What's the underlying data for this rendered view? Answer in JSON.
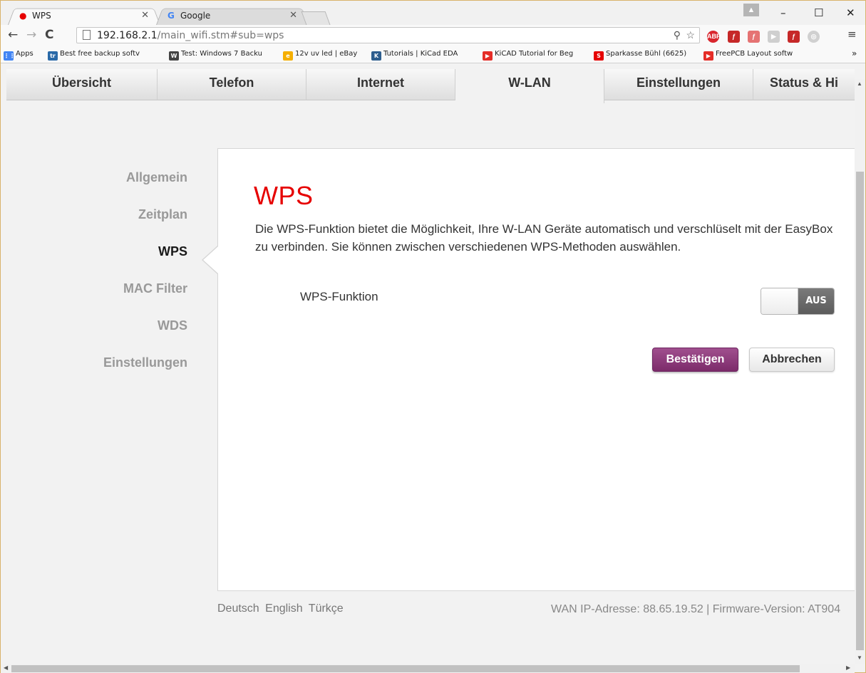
{
  "browser": {
    "tabs": [
      {
        "title": "WPS",
        "active": true,
        "favicon": "vodafone-icon"
      },
      {
        "title": "Google",
        "active": false,
        "favicon": "google-icon"
      }
    ],
    "url_host": "192.168.2.1",
    "url_path": "/main_wifi.stm#sub=wps",
    "bookmarks": [
      {
        "label": "Apps",
        "icon": "apps-icon",
        "color": "#4285f4"
      },
      {
        "label": "Best free backup softv",
        "icon": "tr-icon",
        "color": "#2a6aa8"
      },
      {
        "label": "Test: Windows 7 Backu",
        "icon": "winpro-icon",
        "color": "#444444"
      },
      {
        "label": "12v uv led | eBay",
        "icon": "ebay-icon",
        "color": "#f5af02"
      },
      {
        "label": "Tutorials | KiCad EDA",
        "icon": "kicad-icon",
        "color": "#2e5e8e"
      },
      {
        "label": "KiCAD Tutorial for Beg",
        "icon": "youtube-icon",
        "color": "#e52d27"
      },
      {
        "label": "Sparkasse Bühl (6625)",
        "icon": "sparkasse-icon",
        "color": "#e60000"
      },
      {
        "label": "FreePCB Layout softw",
        "icon": "youtube-icon",
        "color": "#e52d27"
      }
    ],
    "bookmarks_overflow": "»"
  },
  "router": {
    "main_nav": [
      "Übersicht",
      "Telefon",
      "Internet",
      "W-LAN",
      "Einstellungen",
      "Status & Hi"
    ],
    "main_nav_active": "W-LAN",
    "sub_nav": [
      "Allgemein",
      "Zeitplan",
      "WPS",
      "MAC Filter",
      "WDS",
      "Einstellungen"
    ],
    "sub_nav_active": "WPS",
    "title": "WPS",
    "description": "Die WPS-Funktion bietet die Möglichkeit, Ihre W-LAN Geräte automatisch und verschlüselt mit der EasyBox zu verbinden. Sie können zwischen verschiedenen WPS-Methoden auswählen.",
    "wps_function_label": "WPS-Funktion",
    "wps_toggle_state": "AUS",
    "confirm_label": "Bestätigen",
    "cancel_label": "Abbrechen",
    "languages": [
      "Deutsch",
      "English",
      "Türkçe"
    ],
    "footer_info": "WAN IP-Adresse: 88.65.19.52 | Firmware-Version: AT904",
    "accent_color": "#e60000",
    "button_color": "#8a3479"
  }
}
